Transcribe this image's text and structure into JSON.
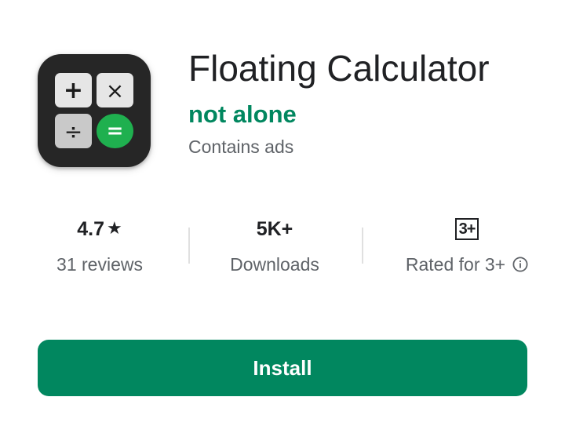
{
  "app": {
    "title": "Floating Calculator",
    "developer": "not alone",
    "ads_notice": "Contains ads",
    "icon": {
      "name": "calculator-app-icon",
      "keys": [
        "+",
        "×",
        "÷",
        "="
      ],
      "background_color": "#262626",
      "equals_key_color": "#1fb04f"
    }
  },
  "stats": {
    "rating": {
      "value": "4.7",
      "star_icon": "★",
      "label": "31 reviews"
    },
    "downloads": {
      "value": "5K+",
      "label": "Downloads"
    },
    "content_rating": {
      "badge": "3+",
      "label": "Rated for 3+",
      "info_icon": "info-icon"
    }
  },
  "install_button": {
    "label": "Install"
  },
  "colors": {
    "accent": "#01875f",
    "text_primary": "#202124",
    "text_secondary": "#5f6368",
    "divider": "#e0e0e0"
  }
}
